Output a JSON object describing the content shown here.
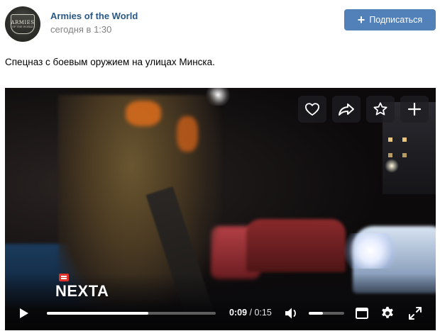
{
  "post": {
    "author": "Armies of the World",
    "date": "сегодня в 1:30",
    "subscribe_label": "Подписаться",
    "text": "Спецназ с боевым оружием на улицах Минска."
  },
  "avatar": {
    "line1": "ARMIES",
    "line2": "OF THE WORLD"
  },
  "video": {
    "watermark": "NEXTA",
    "current_time": "0:09",
    "separator": " / ",
    "duration": "0:15",
    "progress": 0.6,
    "volume": 0.4,
    "overlay_icons": [
      "heart-icon",
      "share-icon",
      "star-icon",
      "plus-icon"
    ],
    "control_icons": [
      "play-icon",
      "volume-icon",
      "miniplayer-icon",
      "settings-icon",
      "fullscreen-icon"
    ]
  },
  "colors": {
    "link": "#2a5885",
    "button": "#5181b8",
    "muted": "#828282"
  }
}
